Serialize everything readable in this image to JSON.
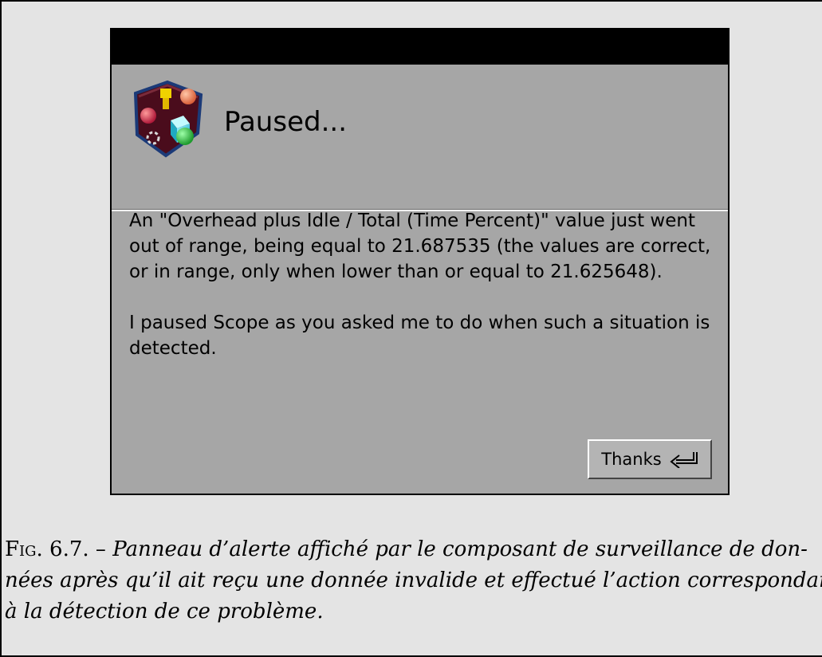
{
  "dialog": {
    "title": "Paused...",
    "icon": "scope-monitor-icon",
    "message_paragraphs": [
      "An \"Overhead plus Idle / Total (Time Percent)\" value just went out of range, being equal to 21.687535 (the values are correct, or in range, only when lower than or equal to 21.625648).",
      "I paused Scope as you asked me to do when such a situation is detected."
    ],
    "button_label": "Thanks",
    "button_icon": "return-key-icon"
  },
  "caption": {
    "label": "Fig. 6.7. –",
    "lines": [
      "Panneau d’alerte affiché par le composant de surveillance de don-",
      "nées après qu’il ait reçu une donnée invalide et effectué l’action correspondant",
      "à la détection de ce problème."
    ]
  },
  "colors": {
    "window_background": "#a6a6a6",
    "titlebar": "#000000",
    "page_background": "#e4e4e4"
  }
}
